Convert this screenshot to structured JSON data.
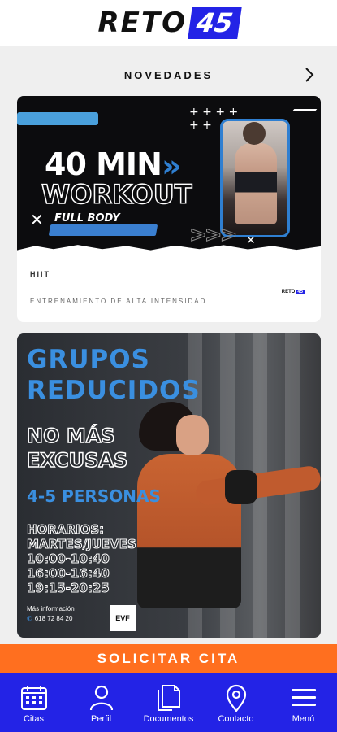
{
  "header": {
    "logo_text": "RETO",
    "logo_number": "45"
  },
  "section": {
    "title": "NOVEDADES",
    "more_icon": "chevron-right-icon"
  },
  "cards": [
    {
      "banner_line1": "40 MIN",
      "banner_line2": "WORKOUT",
      "banner_tag": "FULL BODY",
      "title": "HIIT",
      "subtitle": "ENTRENAMIENTO DE ALTA INTENSIDAD",
      "mini_logo_text": "RETO",
      "mini_logo_number": "45"
    },
    {
      "title_line1": "GRUPOS",
      "title_line2": "REDUCIDOS",
      "line3": "NO MÁS",
      "line4": "EXCUSAS",
      "people": "4-5 PERSONAS",
      "hours": [
        "HORARIOS:",
        "MARTES/JUEVES",
        "10:00-10:40",
        "16:00-16:40",
        "19:15-20:25"
      ],
      "info": "Más información",
      "phone": "618 72 84 20"
    }
  ],
  "cta": {
    "label": "SOLICITAR CITA"
  },
  "tabbar": {
    "items": [
      {
        "label": "Citas",
        "icon": "calendar-icon"
      },
      {
        "label": "Perfil",
        "icon": "user-icon"
      },
      {
        "label": "Documentos",
        "icon": "documents-icon"
      },
      {
        "label": "Contacto",
        "icon": "location-pin-icon"
      },
      {
        "label": "Menú",
        "icon": "menu-icon"
      }
    ]
  },
  "colors": {
    "brand_blue": "#2323e6",
    "accent_orange": "#ff6f1f",
    "banner_blue": "#3a8fe0"
  }
}
